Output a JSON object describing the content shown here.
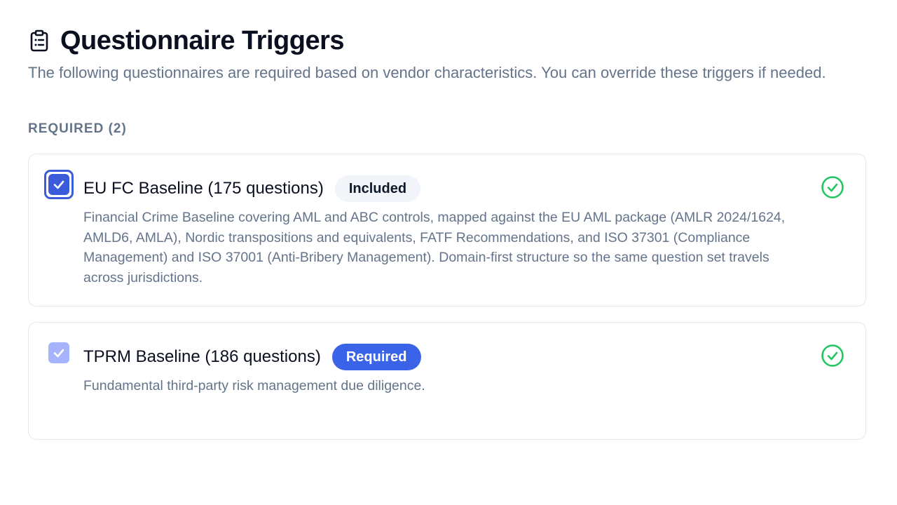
{
  "header": {
    "title": "Questionnaire Triggers",
    "icon": "clipboard-list-icon",
    "subtitle": "The following questionnaires are required based on vendor characteristics. You can override these triggers if needed."
  },
  "section": {
    "label": "REQUIRED (2)"
  },
  "questionnaires": [
    {
      "title": "EU FC Baseline (175 questions)",
      "badge": "Included",
      "checked": true,
      "description": "Financial Crime Baseline covering AML and ABC controls, mapped against the EU AML package (AMLR 2024/1624, AMLD6, AMLA), Nordic transpositions and equivalents, FATF Recommendations, and ISO 37301 (Compliance Management) and ISO 37001 (Anti-Bribery Management). Domain-first structure so the same question set travels across jurisdictions.",
      "status_icon": "check-circle-icon"
    },
    {
      "title": "TPRM Baseline (186 questions)",
      "badge": "Required",
      "checked": true,
      "description": "Fundamental third-party risk management due diligence.",
      "status_icon": "check-circle-icon"
    }
  ],
  "colors": {
    "accent": "#3b5bdb",
    "badge_required_bg": "#3b63e8",
    "badge_included_bg": "#f1f5f9",
    "success": "#22c55e",
    "muted_text": "#64748b",
    "border": "#e2e8f0"
  }
}
